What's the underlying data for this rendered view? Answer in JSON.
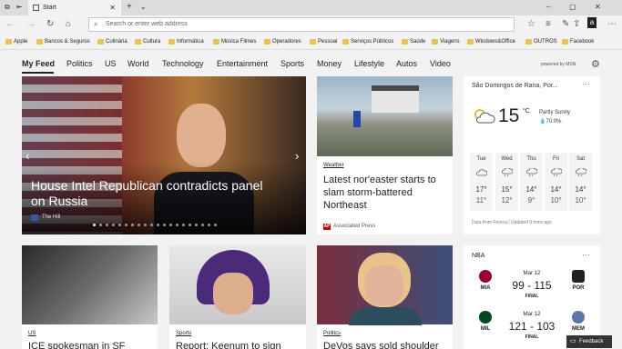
{
  "browser": {
    "tab_title": "Start",
    "tab_close": "✕",
    "new_tab": "+",
    "tab_menu": "⌄",
    "address_placeholder": "Search or enter web address",
    "window_controls": [
      "–",
      "▢",
      "✕"
    ]
  },
  "favorites": [
    "Apple",
    "Bancos & Seguros",
    "Culinária",
    "Cultura",
    "Informática",
    "Música Filmes",
    "Operadores",
    "Pessoal",
    "Serviços Públicos",
    "Saúde",
    "Viagens",
    "Windows&Office",
    "OUTROS",
    "Facebook"
  ],
  "nav": {
    "items": [
      "My Feed",
      "Politics",
      "US",
      "World",
      "Technology",
      "Entertainment",
      "Sports",
      "Money",
      "Lifestyle",
      "Autos",
      "Video"
    ],
    "powered_by": "powered by MSN"
  },
  "hero": {
    "title": "House Intel Republican contradicts panel on Russia",
    "source": "The Hill",
    "slides_total": 20,
    "slide_active": 1
  },
  "cards": [
    {
      "category": "Weather",
      "title": "Latest nor'easter starts to slam storm-battered Northeast",
      "source": "Associated Press"
    },
    {
      "category": "US",
      "title": "ICE spokesman in SF"
    },
    {
      "category": "Sports",
      "title": "Report: Keenum to sign"
    },
    {
      "category": "Politics",
      "title": "DeVos says sold shoulder"
    }
  ],
  "weather": {
    "location": "São Domingos de Rana, Por...",
    "temp": "15",
    "unit": "°C",
    "condition": "Partly Sunny",
    "humidity": "70.0%",
    "days": [
      {
        "day": "Tue",
        "hi": "17°",
        "lo": "11°"
      },
      {
        "day": "Wed",
        "hi": "15°",
        "lo": "12°"
      },
      {
        "day": "Thu",
        "hi": "14°",
        "lo": "9°"
      },
      {
        "day": "Fri",
        "hi": "14°",
        "lo": "10°"
      },
      {
        "day": "Sat",
        "hi": "14°",
        "lo": "10°"
      }
    ],
    "footer": "Data from Foreca | Updated 9 mins ago"
  },
  "nba": {
    "title": "NBA",
    "games": [
      {
        "date": "Mar 12",
        "score": "99 - 115",
        "status": "FINAL",
        "home": "MIA",
        "away": "POR"
      },
      {
        "date": "Mar 12",
        "score": "121 - 103",
        "status": "FINAL",
        "home": "MIL",
        "away": "MEM"
      }
    ]
  },
  "feedback": "Feedback"
}
